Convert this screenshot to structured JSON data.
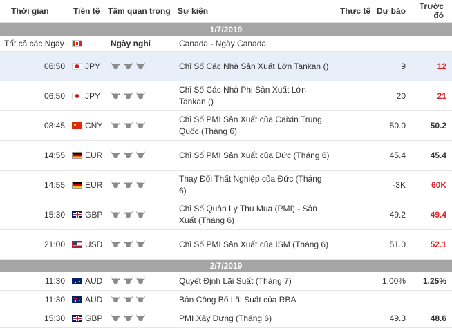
{
  "header": {
    "time": "Thời gian",
    "currency": "Tiền tệ",
    "importance": "Tầm quan trọng",
    "event": "Sự kiện",
    "actual": "Thực tế",
    "forecast": "Dự báo",
    "previous": "Trước đó"
  },
  "days": [
    {
      "date": "1/7/2019",
      "holiday": {
        "time": "Tất cả các Ngày",
        "flag": "ca",
        "label": "Ngày nghỉ",
        "event": "Canada - Ngày Canada"
      },
      "rows": [
        {
          "time": "06:50",
          "flag": "jp",
          "currency": "JPY",
          "bulls": 3,
          "event": "Chỉ Số Các Nhà Sản Xuất Lớn Tankan ()",
          "actual": "",
          "forecast": "9",
          "previous": "12",
          "prev_red": true,
          "highlight": true,
          "tall": true
        },
        {
          "time": "06:50",
          "flag": "jp",
          "currency": "JPY",
          "bulls": 3,
          "event": "Chỉ Số Các Nhà Phi Sản Xuất Lớn Tankan ()",
          "actual": "",
          "forecast": "20",
          "previous": "21",
          "prev_red": true,
          "tall": true
        },
        {
          "time": "08:45",
          "flag": "cn",
          "currency": "CNY",
          "bulls": 3,
          "event": "Chỉ Số PMI Sản Xuất của Caixin Trung Quốc (Tháng 6)",
          "actual": "",
          "forecast": "50.0",
          "previous": "50.2",
          "tall": true
        },
        {
          "time": "14:55",
          "flag": "de",
          "currency": "EUR",
          "bulls": 3,
          "event": "Chỉ Số PMI Sản Xuất của Đức (Tháng 6)",
          "actual": "",
          "forecast": "45.4",
          "previous": "45.4",
          "tall": true
        },
        {
          "time": "14:55",
          "flag": "de",
          "currency": "EUR",
          "bulls": 3,
          "event": "Thay Đổi Thất Nghiệp của Đức (Tháng 6)",
          "actual": "",
          "forecast": "-3K",
          "previous": "60K",
          "prev_red": true,
          "tall": true
        },
        {
          "time": "15:30",
          "flag": "gb",
          "currency": "GBP",
          "bulls": 3,
          "event": "Chỉ Số Quản Lý Thu Mua (PMI) - Sản Xuất (Tháng 6)",
          "actual": "",
          "forecast": "49.2",
          "previous": "49.4",
          "prev_red": true,
          "tall": true
        },
        {
          "time": "21:00",
          "flag": "us",
          "currency": "USD",
          "bulls": 3,
          "event": "Chỉ Số PMI Sản Xuất của ISM (Tháng 6)",
          "actual": "",
          "forecast": "51.0",
          "previous": "52.1",
          "prev_red": true,
          "tall": true
        }
      ]
    },
    {
      "date": "2/7/2019",
      "rows": [
        {
          "time": "11:30",
          "flag": "au",
          "currency": "AUD",
          "bulls": 3,
          "event": "Quyết Định Lãi Suất (Tháng 7)",
          "actual": "",
          "forecast": "1.00%",
          "previous": "1.25%"
        },
        {
          "time": "11:30",
          "flag": "au",
          "currency": "AUD",
          "bulls": 3,
          "event": "Bản Công Bố Lãi Suất của RBA",
          "actual": "",
          "forecast": "",
          "previous": ""
        },
        {
          "time": "15:30",
          "flag": "gb",
          "currency": "GBP",
          "bulls": 3,
          "event": "PMI Xây Dựng (Tháng 6)",
          "actual": "",
          "forecast": "49.3",
          "previous": "48.6"
        }
      ]
    }
  ],
  "colors": {
    "day_bar": "#a5a5a5",
    "highlight_row": "#e8eff8",
    "negative": "#e0202a",
    "bull": "#8a8a8a"
  },
  "icons": {
    "importance": "bull-icon"
  }
}
